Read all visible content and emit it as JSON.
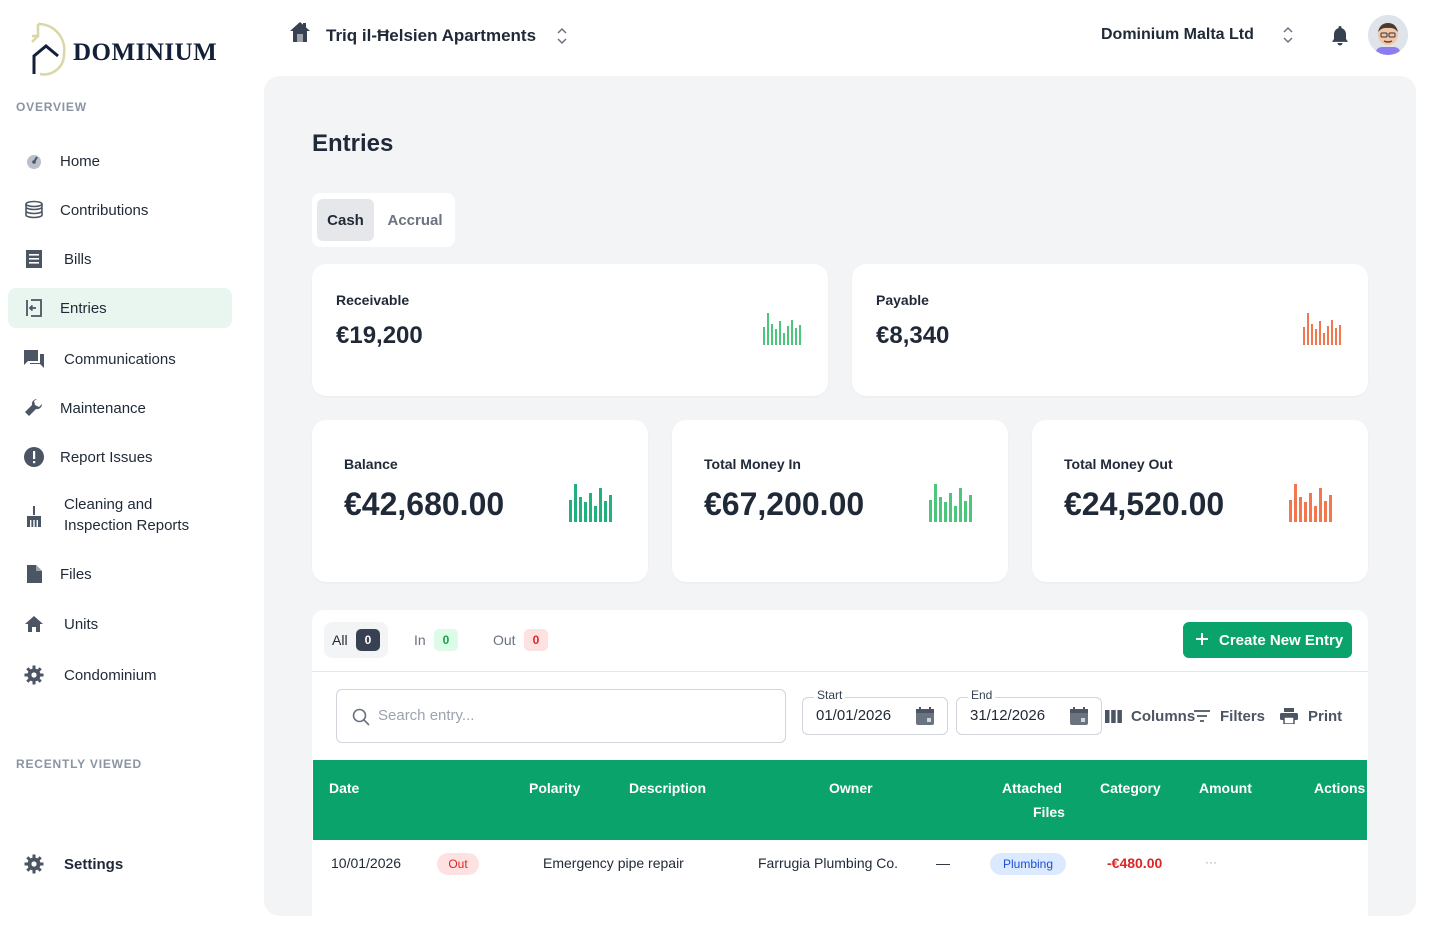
{
  "brand": {
    "name": "DOMINIUM",
    "accent": "#09a36b"
  },
  "sidebar": {
    "overview_label": "OVERVIEW",
    "recent_label": "RECENTLY VIEWED",
    "items": [
      {
        "label": "Home",
        "icon": "gauge-icon"
      },
      {
        "label": "Contributions",
        "icon": "coins-icon"
      },
      {
        "label": "Bills",
        "icon": "receipt-icon"
      },
      {
        "label": "Entries",
        "icon": "entry-icon"
      },
      {
        "label": "Communications",
        "icon": "chat-icon"
      },
      {
        "label": "Maintenance",
        "icon": "wrench-icon"
      },
      {
        "label": "Report Issues",
        "icon": "alert-icon"
      },
      {
        "label": "Cleaning and Inspection Reports",
        "label_line1": "Cleaning and",
        "label_line2": "Inspection Reports",
        "icon": "broom-icon"
      },
      {
        "label": "Files",
        "icon": "file-icon"
      },
      {
        "label": "Units",
        "icon": "house-icon"
      },
      {
        "label": "Condominium",
        "icon": "gear-icon"
      }
    ],
    "settings_label": "Settings"
  },
  "topbar": {
    "property_name": "Triq il-Ħelsien Apartments",
    "org_name": "Dominium Malta Ltd"
  },
  "page": {
    "title": "Entries",
    "basis": {
      "options": [
        "Cash",
        "Accrual"
      ],
      "selected": "Cash"
    }
  },
  "summary": {
    "receivable": {
      "label": "Receivable",
      "value": "€19,200"
    },
    "payable": {
      "label": "Payable",
      "value": "€8,340"
    },
    "balance": {
      "label": "Balance",
      "value": "€42,680.00"
    },
    "money_in": {
      "label": "Total Money In",
      "value": "€67,200.00"
    },
    "money_out": {
      "label": "Total Money Out",
      "value": "€24,520.00"
    },
    "colors": {
      "positive": "#4cc67a",
      "negative": "#f2774f",
      "balance": "#22b07d"
    }
  },
  "filters": {
    "tabs": [
      {
        "label": "All",
        "count": "0"
      },
      {
        "label": "In",
        "count": "0"
      },
      {
        "label": "Out",
        "count": "0"
      }
    ],
    "create_label": "Create New Entry",
    "search_placeholder": "Search entry...",
    "start_label": "Start",
    "start_value": "01/01/2026",
    "end_label": "End",
    "end_value": "31/12/2026",
    "columns_label": "Columns",
    "filters_label": "Filters",
    "print_label": "Print"
  },
  "table": {
    "headers": {
      "date": "Date",
      "polarity": "Polarity",
      "description": "Description",
      "owner": "Owner",
      "attached_1": "Attached",
      "attached_2": "Files",
      "category": "Category",
      "amount": "Amount",
      "actions": "Actions"
    },
    "rows": [
      {
        "date": "10/01/2026",
        "polarity": "Out",
        "description": "Emergency pipe repair",
        "owner": "Farrugia Plumbing Co.",
        "attached": "—",
        "category": "Plumbing",
        "amount": "-€480.00",
        "actions": "···"
      }
    ]
  }
}
